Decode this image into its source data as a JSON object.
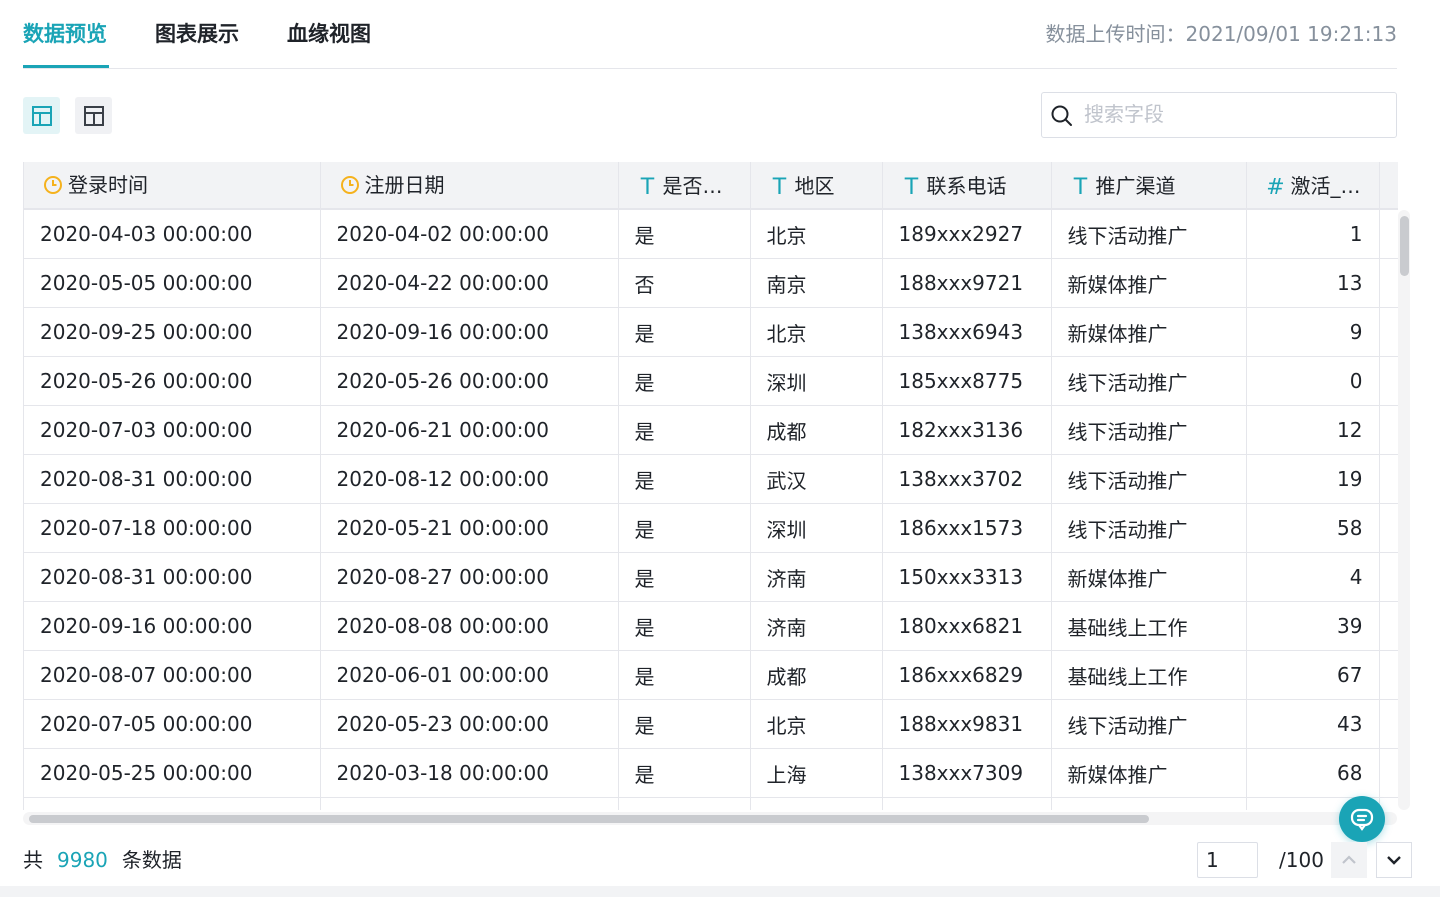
{
  "tabs": [
    {
      "label": "数据预览",
      "active": true
    },
    {
      "label": "图表展示",
      "active": false
    },
    {
      "label": "血缘视图",
      "active": false
    }
  ],
  "upload_time": "数据上传时间：2021/09/01 19:21:13",
  "search": {
    "placeholder": "搜索字段",
    "value": ""
  },
  "columns": [
    {
      "label": "登录时间",
      "icon": "clock-icon"
    },
    {
      "label": "注册日期",
      "icon": "clock-icon"
    },
    {
      "label": "是否…",
      "icon": "text-type-icon"
    },
    {
      "label": "地区",
      "icon": "text-type-icon"
    },
    {
      "label": "联系电话",
      "icon": "text-type-icon"
    },
    {
      "label": "推广渠道",
      "icon": "text-type-icon"
    },
    {
      "label": "激活_…",
      "icon": "number-type-icon"
    }
  ],
  "rows": [
    [
      "2020-04-03 00:00:00",
      "2020-04-02 00:00:00",
      "是",
      "北京",
      "189xxx2927",
      "线下活动推广",
      "1"
    ],
    [
      "2020-05-05 00:00:00",
      "2020-04-22 00:00:00",
      "否",
      "南京",
      "188xxx9721",
      "新媒体推广",
      "13"
    ],
    [
      "2020-09-25 00:00:00",
      "2020-09-16 00:00:00",
      "是",
      "北京",
      "138xxx6943",
      "新媒体推广",
      "9"
    ],
    [
      "2020-05-26 00:00:00",
      "2020-05-26 00:00:00",
      "是",
      "深圳",
      "185xxx8775",
      "线下活动推广",
      "0"
    ],
    [
      "2020-07-03 00:00:00",
      "2020-06-21 00:00:00",
      "是",
      "成都",
      "182xxx3136",
      "线下活动推广",
      "12"
    ],
    [
      "2020-08-31 00:00:00",
      "2020-08-12 00:00:00",
      "是",
      "武汉",
      "138xxx3702",
      "线下活动推广",
      "19"
    ],
    [
      "2020-07-18 00:00:00",
      "2020-05-21 00:00:00",
      "是",
      "深圳",
      "186xxx1573",
      "线下活动推广",
      "58"
    ],
    [
      "2020-08-31 00:00:00",
      "2020-08-27 00:00:00",
      "是",
      "济南",
      "150xxx3313",
      "新媒体推广",
      "4"
    ],
    [
      "2020-09-16 00:00:00",
      "2020-08-08 00:00:00",
      "是",
      "济南",
      "180xxx6821",
      "基础线上工作",
      "39"
    ],
    [
      "2020-08-07 00:00:00",
      "2020-06-01 00:00:00",
      "是",
      "成都",
      "186xxx6829",
      "基础线上工作",
      "67"
    ],
    [
      "2020-07-05 00:00:00",
      "2020-05-23 00:00:00",
      "是",
      "北京",
      "188xxx9831",
      "线下活动推广",
      "43"
    ],
    [
      "2020-05-25 00:00:00",
      "2020-03-18 00:00:00",
      "是",
      "上海",
      "138xxx7309",
      "新媒体推广",
      "68"
    ],
    [
      "",
      "",
      "",
      "",
      "",
      "",
      ""
    ]
  ],
  "footer": {
    "total_prefix": "共",
    "total_count": "9980",
    "total_suffix": "条数据",
    "page_value": "1",
    "page_total": "/100"
  },
  "colors": {
    "accent": "#1aa4b6",
    "clock": "#f5b21d"
  }
}
